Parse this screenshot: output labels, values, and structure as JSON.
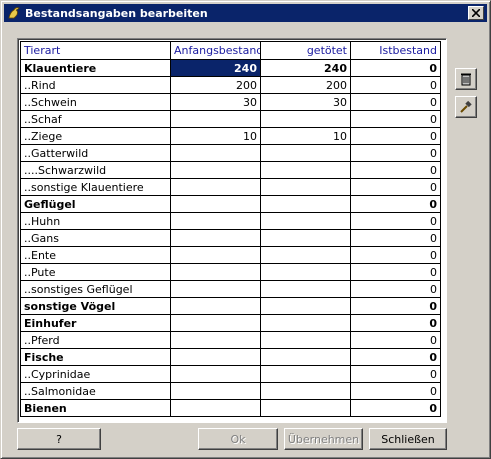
{
  "window": {
    "title": "Bestandsangaben bearbeiten"
  },
  "table": {
    "columns": [
      "Tierart",
      "Anfangsbestand",
      "getötet",
      "Istbestand"
    ],
    "rows": [
      {
        "tierart": "Klauentiere",
        "anfang": "240",
        "getoetet": "240",
        "ist": "0",
        "bold": true
      },
      {
        "tierart": "..Rind",
        "anfang": "200",
        "getoetet": "200",
        "ist": "0",
        "bold": false
      },
      {
        "tierart": "..Schwein",
        "anfang": "30",
        "getoetet": "30",
        "ist": "0",
        "bold": false
      },
      {
        "tierart": "..Schaf",
        "anfang": "",
        "getoetet": "",
        "ist": "0",
        "bold": false
      },
      {
        "tierart": "..Ziege",
        "anfang": "10",
        "getoetet": "10",
        "ist": "0",
        "bold": false
      },
      {
        "tierart": "..Gatterwild",
        "anfang": "",
        "getoetet": "",
        "ist": "0",
        "bold": false
      },
      {
        "tierart": "....Schwarzwild",
        "anfang": "",
        "getoetet": "",
        "ist": "0",
        "bold": false
      },
      {
        "tierart": "..sonstige Klauentiere",
        "anfang": "",
        "getoetet": "",
        "ist": "0",
        "bold": false
      },
      {
        "tierart": "Geflügel",
        "anfang": "",
        "getoetet": "",
        "ist": "0",
        "bold": true
      },
      {
        "tierart": "..Huhn",
        "anfang": "",
        "getoetet": "",
        "ist": "0",
        "bold": false
      },
      {
        "tierart": "..Gans",
        "anfang": "",
        "getoetet": "",
        "ist": "0",
        "bold": false
      },
      {
        "tierart": "..Ente",
        "anfang": "",
        "getoetet": "",
        "ist": "0",
        "bold": false
      },
      {
        "tierart": "..Pute",
        "anfang": "",
        "getoetet": "",
        "ist": "0",
        "bold": false
      },
      {
        "tierart": "..sonstiges Geflügel",
        "anfang": "",
        "getoetet": "",
        "ist": "0",
        "bold": false
      },
      {
        "tierart": "sonstige Vögel",
        "anfang": "",
        "getoetet": "",
        "ist": "0",
        "bold": true
      },
      {
        "tierart": "Einhufer",
        "anfang": "",
        "getoetet": "",
        "ist": "0",
        "bold": true
      },
      {
        "tierart": "..Pferd",
        "anfang": "",
        "getoetet": "",
        "ist": "0",
        "bold": false
      },
      {
        "tierart": "Fische",
        "anfang": "",
        "getoetet": "",
        "ist": "0",
        "bold": true
      },
      {
        "tierart": "..Cyprinidae",
        "anfang": "",
        "getoetet": "",
        "ist": "0",
        "bold": false
      },
      {
        "tierart": "..Salmonidae",
        "anfang": "",
        "getoetet": "",
        "ist": "0",
        "bold": false
      },
      {
        "tierart": "Bienen",
        "anfang": "",
        "getoetet": "",
        "ist": "0",
        "bold": true
      }
    ]
  },
  "side_buttons": {
    "delete_icon": "trash-icon",
    "edit_icon": "hammer-icon"
  },
  "buttons": {
    "help": "?",
    "ok": "Ok",
    "apply": "Übernehmen",
    "close": "Schließen"
  },
  "colors": {
    "titlebar": "#0a246a",
    "selection": "#0a246a",
    "header_text": "#1a1aa0"
  }
}
